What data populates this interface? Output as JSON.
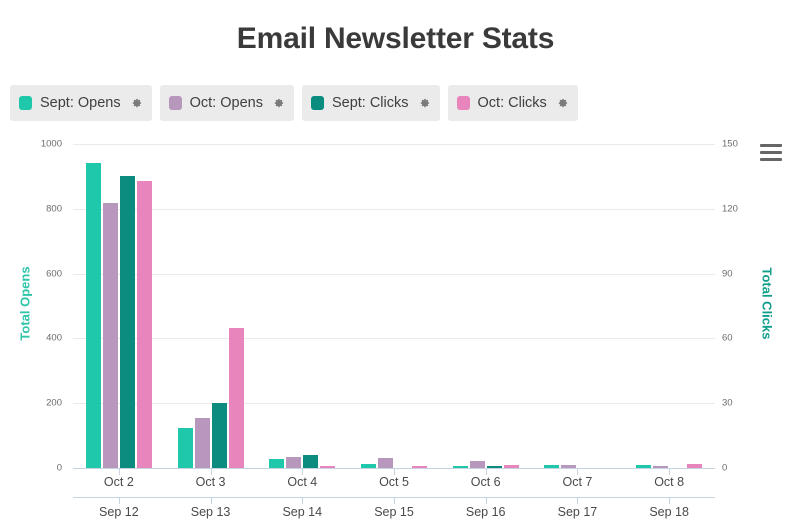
{
  "title": "Email Newsletter Stats",
  "legend": {
    "items": [
      {
        "label": "Sept: Opens",
        "color": "#1fc8ab",
        "icon": "gear-icon"
      },
      {
        "label": "Oct: Opens",
        "color": "#b897bd",
        "icon": "gear-icon"
      },
      {
        "label": "Sept: Clicks",
        "color": "#0b8c7f",
        "icon": "gear-icon"
      },
      {
        "label": "Oct: Clicks",
        "color": "#e985bd",
        "icon": "gear-icon"
      }
    ]
  },
  "menu": {
    "icon": "hamburger-menu-icon"
  },
  "chart_data": {
    "type": "bar",
    "title": "Email Newsletter Stats",
    "categories": [
      "Oct 2",
      "Oct 3",
      "Oct 4",
      "Oct 5",
      "Oct 6",
      "Oct 7",
      "Oct 8"
    ],
    "categories_secondary": [
      "Sep 12",
      "Sep 13",
      "Sep 14",
      "Sep 15",
      "Sep 16",
      "Sep 17",
      "Sep 18"
    ],
    "xlabel": "",
    "ylabel": "Total Opens",
    "ylabel_secondary": "Total Clicks",
    "ylim": [
      0,
      1000
    ],
    "ylim_secondary": [
      0,
      150
    ],
    "yticks": [
      0,
      200,
      400,
      600,
      800,
      1000
    ],
    "yticks_secondary": [
      0,
      30,
      60,
      90,
      120,
      150
    ],
    "grid": true,
    "legend_position": "top-left",
    "series": [
      {
        "name": "Sept: Opens",
        "axis": "left",
        "color": "#1fc8ab",
        "values": [
          940,
          125,
          28,
          12,
          6,
          9,
          8
        ]
      },
      {
        "name": "Oct: Opens",
        "axis": "left",
        "color": "#b897bd",
        "values": [
          818,
          155,
          33,
          30,
          22,
          10,
          5
        ]
      },
      {
        "name": "Sept: Clicks",
        "axis": "right",
        "color": "#0b8c7f",
        "values": [
          135,
          30,
          6,
          0,
          1,
          0,
          0
        ]
      },
      {
        "name": "Oct: Clicks",
        "axis": "right",
        "color": "#e985bd",
        "values": [
          133,
          65,
          1,
          1,
          1.5,
          0,
          2
        ]
      }
    ]
  }
}
